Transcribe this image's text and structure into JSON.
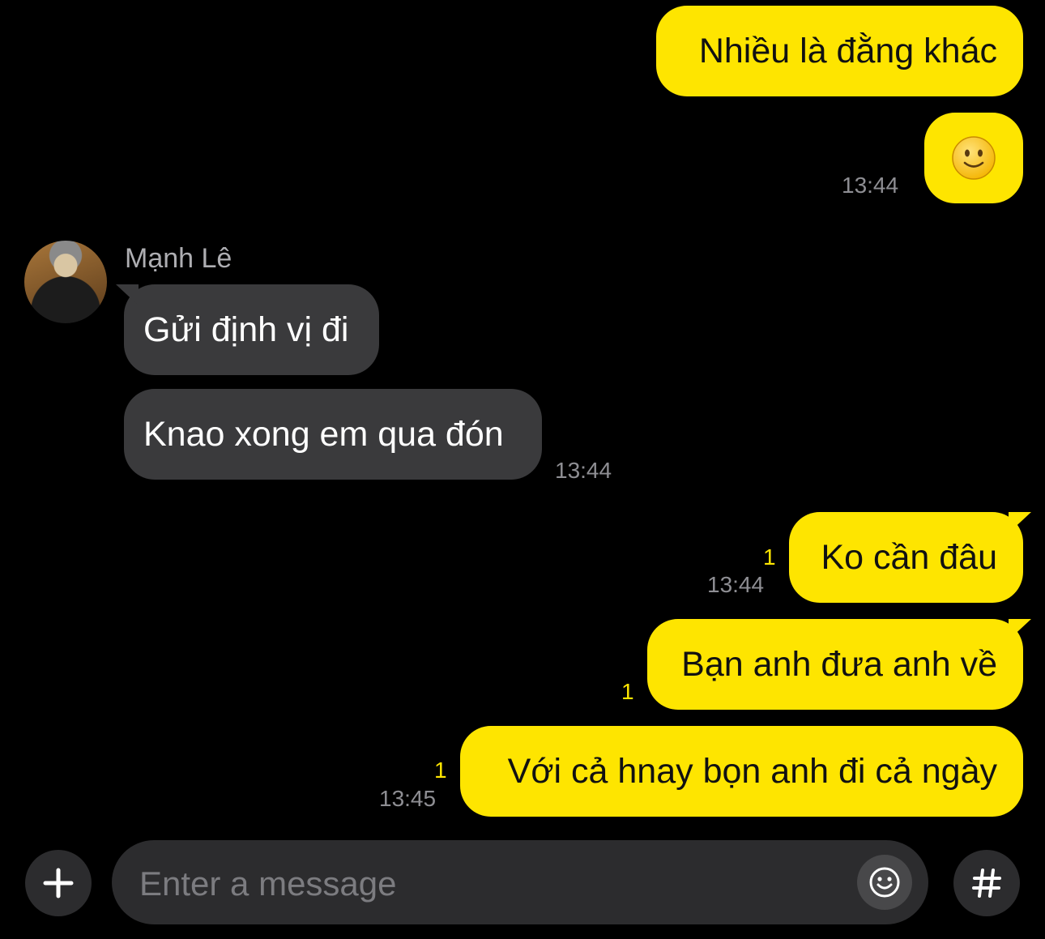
{
  "messages": {
    "m1": {
      "text": "Nhiều là đằng khác"
    },
    "m2": {
      "emoji": "🙂",
      "time": "13:44"
    },
    "sender": {
      "name": "Mạnh Lê"
    },
    "m3": {
      "text": "Gửi định vị đi"
    },
    "m4": {
      "text": "Knao xong em qua đón",
      "time": "13:44"
    },
    "m5": {
      "text": "Ko cần đâu",
      "unread": "1",
      "time": "13:44"
    },
    "m6": {
      "text": "Bạn anh đưa anh về",
      "unread": "1"
    },
    "m7": {
      "text": "Với cả hnay bọn anh đi cả ngày",
      "unread": "1",
      "time": "13:45"
    }
  },
  "composer": {
    "placeholder": "Enter a message",
    "plus_icon": "plus-icon",
    "emoji_icon": "emoticon-icon",
    "hash_icon": "hash-icon"
  },
  "colors": {
    "outgoing_bubble": "#FEE500",
    "incoming_bubble": "#3A3A3C",
    "background": "#000000"
  }
}
